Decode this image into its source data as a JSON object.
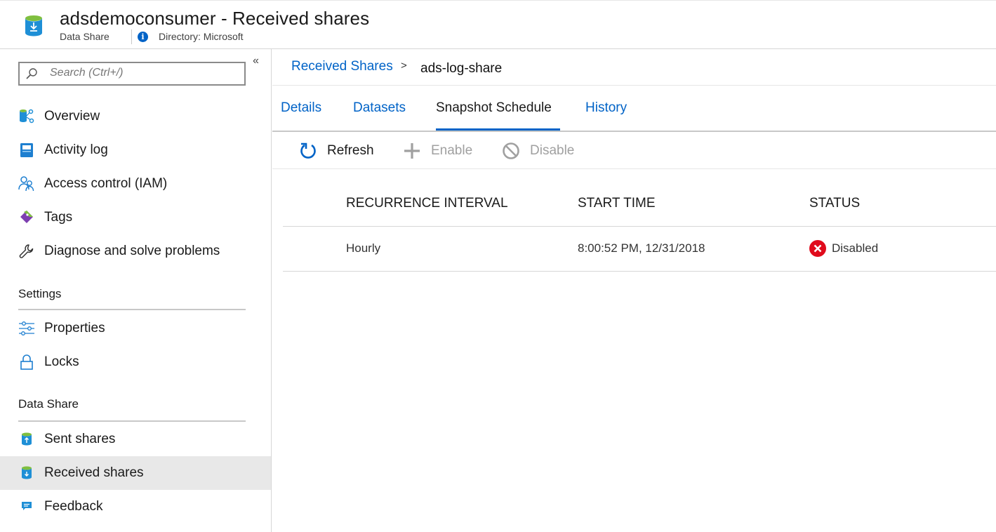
{
  "header": {
    "title": "adsdemoconsumer - Received shares",
    "subtitle": "Data Share",
    "directory": "Directory: Microsoft"
  },
  "sidebar": {
    "search_placeholder": "Search (Ctrl+/)",
    "items": [
      {
        "label": "Overview",
        "icon": "overview-icon"
      },
      {
        "label": "Activity log",
        "icon": "activity-log-icon"
      },
      {
        "label": "Access control (IAM)",
        "icon": "people-icon"
      },
      {
        "label": "Tags",
        "icon": "tag-icon"
      },
      {
        "label": "Diagnose and solve problems",
        "icon": "wrench-icon"
      }
    ],
    "sections": [
      {
        "title": "Settings",
        "items": [
          {
            "label": "Properties",
            "icon": "sliders-icon"
          },
          {
            "label": "Locks",
            "icon": "lock-icon"
          }
        ]
      },
      {
        "title": "Data Share",
        "items": [
          {
            "label": "Sent shares",
            "icon": "sent-share-icon"
          },
          {
            "label": "Received shares",
            "icon": "received-share-icon",
            "active": true
          },
          {
            "label": "Feedback",
            "icon": "feedback-icon"
          }
        ]
      }
    ]
  },
  "breadcrumb": {
    "parent": "Received Shares",
    "separator": ">",
    "current": "ads-log-share"
  },
  "tabs": [
    {
      "label": "Details"
    },
    {
      "label": "Datasets"
    },
    {
      "label": "Snapshot Schedule",
      "active": true
    },
    {
      "label": "History"
    }
  ],
  "toolbar": {
    "refresh": "Refresh",
    "enable": "Enable",
    "disable": "Disable"
  },
  "table": {
    "columns": [
      "RECURRENCE INTERVAL",
      "START TIME",
      "STATUS"
    ],
    "rows": [
      {
        "recurrence": "Hourly",
        "start_time": "8:00:52 PM, 12/31/2018",
        "status": "Disabled"
      }
    ]
  },
  "colors": {
    "accent": "#0063c7",
    "error": "#e00b1c",
    "active_bg": "#e8e8e8"
  }
}
